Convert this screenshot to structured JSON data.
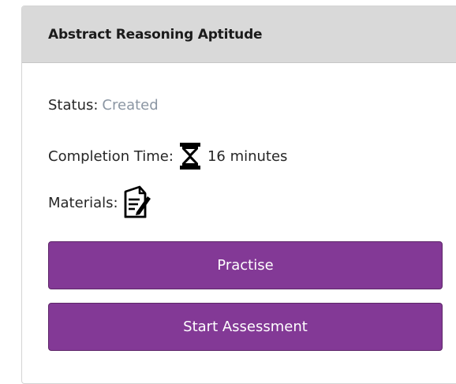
{
  "card": {
    "title": "Abstract Reasoning Aptitude",
    "status_label": "Status:",
    "status_value": "Created",
    "completion_label": "Completion Time:",
    "completion_icon": "hourglass-icon",
    "completion_value": "16 minutes",
    "materials_label": "Materials:",
    "materials_icon": "document-pencil-icon"
  },
  "buttons": {
    "practise_label": "Practise",
    "start_label": "Start Assessment"
  },
  "colors": {
    "header_bg": "#d9d9d9",
    "button_bg": "#833996",
    "status_value": "#8b96a3"
  }
}
